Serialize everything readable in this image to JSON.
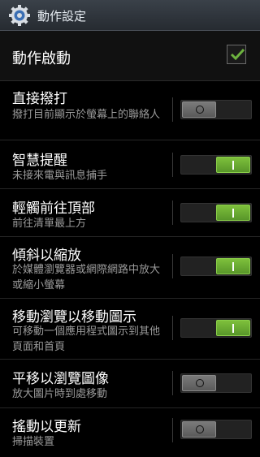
{
  "header": {
    "title": "動作設定",
    "icon": "gear-icon"
  },
  "master": {
    "label": "動作啟動",
    "checked": true
  },
  "settings": [
    {
      "title": "直接撥打",
      "desc": "撥打目前顯示於螢幕上的聯絡人",
      "on": false
    },
    {
      "title": "智慧提醒",
      "desc": "未接來電與訊息捕手",
      "on": true
    },
    {
      "title": "輕觸前往頂部",
      "desc": "前往清單最上方",
      "on": true
    },
    {
      "title": "傾斜以縮放",
      "desc": "於媒體瀏覽器或網際網路中放大或縮小螢幕",
      "on": true
    },
    {
      "title": "移動瀏覽以移動圖示",
      "desc": "可移動一個應用程式圖示到其他頁面和首頁",
      "on": true
    },
    {
      "title": "平移以瀏覽圖像",
      "desc": "放大圖片時到處移動",
      "on": false
    },
    {
      "title": "搖動以更新",
      "desc": "掃描裝置",
      "on": false
    }
  ],
  "colors": {
    "accent": "#6db33f",
    "header_bg": "#2f353c"
  }
}
